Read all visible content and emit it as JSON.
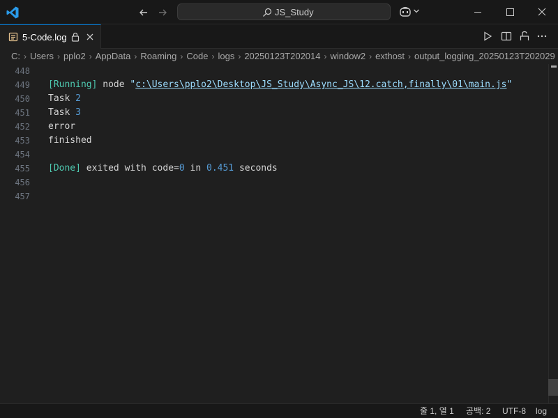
{
  "titlebar": {
    "search_text": "JS_Study",
    "icons": [
      "vscode-logo",
      "arrow-left-icon",
      "arrow-right-icon",
      "search-icon",
      "copilot-icon",
      "chevron-down-icon",
      "minimize-icon",
      "maximize-icon",
      "close-icon"
    ]
  },
  "tab": {
    "label": "5-Code.log",
    "icons": [
      "log-file-icon",
      "lock-icon",
      "close-icon"
    ]
  },
  "editor_actions": [
    "run-icon",
    "split-editor-icon",
    "open-changes-icon",
    "more-icon"
  ],
  "breadcrumbs": [
    "C:",
    "Users",
    "pplo2",
    "AppData",
    "Roaming",
    "Code",
    "logs",
    "20250123T202014",
    "window2",
    "exthost",
    "output_logging_20250123T202029"
  ],
  "lines": [
    {
      "n": "448",
      "parts": []
    },
    {
      "n": "449",
      "parts": [
        {
          "t": "[Running]",
          "c": "tag"
        },
        {
          "t": " node ",
          "c": ""
        },
        {
          "t": "\"",
          "c": "str"
        },
        {
          "t": "c:\\Users\\pplo2\\Desktop\\JS_Study\\Async_JS\\12.catch,finally\\01\\main.js",
          "c": "link"
        },
        {
          "t": "\"",
          "c": "str"
        }
      ]
    },
    {
      "n": "450",
      "parts": [
        {
          "t": "Task ",
          "c": ""
        },
        {
          "t": "2",
          "c": "blue"
        }
      ]
    },
    {
      "n": "451",
      "parts": [
        {
          "t": "Task ",
          "c": ""
        },
        {
          "t": "3",
          "c": "blue"
        }
      ]
    },
    {
      "n": "452",
      "parts": [
        {
          "t": "error",
          "c": ""
        }
      ]
    },
    {
      "n": "453",
      "parts": [
        {
          "t": "finished",
          "c": ""
        }
      ]
    },
    {
      "n": "454",
      "parts": []
    },
    {
      "n": "455",
      "parts": [
        {
          "t": "[Done]",
          "c": "tag"
        },
        {
          "t": " exited with code=",
          "c": ""
        },
        {
          "t": "0",
          "c": "blue"
        },
        {
          "t": " in ",
          "c": ""
        },
        {
          "t": "0.451",
          "c": "blue"
        },
        {
          "t": " seconds",
          "c": ""
        }
      ]
    },
    {
      "n": "456",
      "parts": []
    },
    {
      "n": "457",
      "parts": []
    }
  ],
  "statusbar": {
    "position": "줄 1, 열 1",
    "indent": "공백: 2",
    "encoding": "UTF-8",
    "language": "log"
  }
}
